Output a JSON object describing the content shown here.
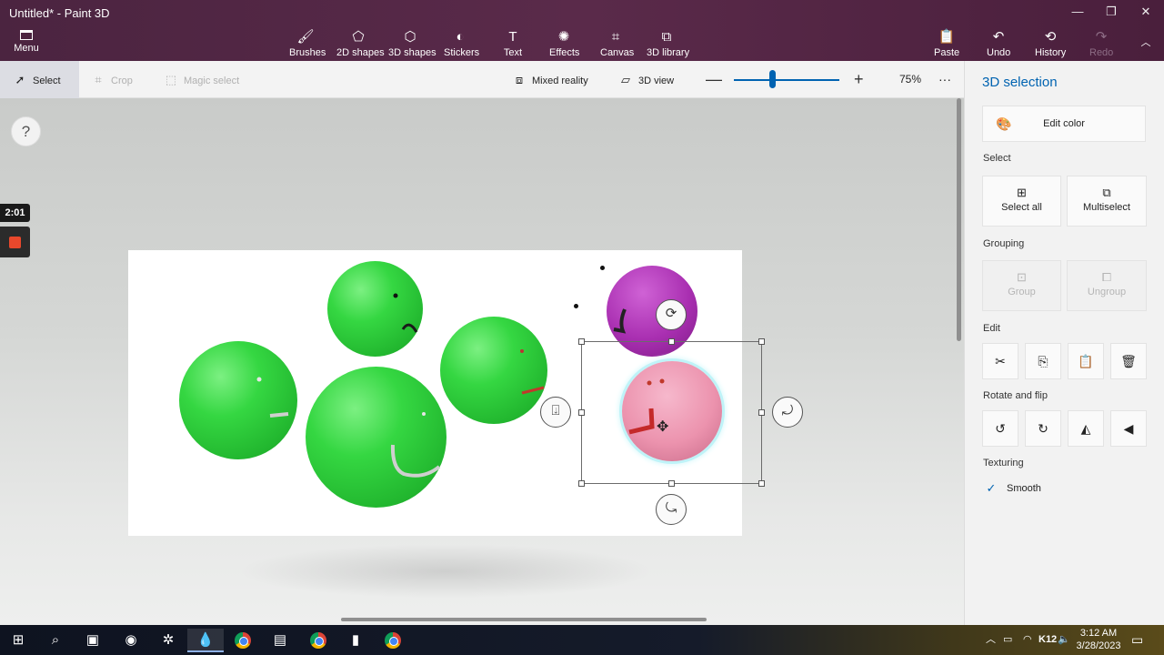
{
  "window": {
    "title": "Untitled* - Paint 3D",
    "minimize": "—",
    "maximize": "❐",
    "close": "✕"
  },
  "ribbon": {
    "menu_label": "Menu",
    "tools": [
      {
        "label": "Brushes",
        "icon": "brush-icon",
        "glyph": "🖌"
      },
      {
        "label": "2D shapes",
        "icon": "2d-shapes-icon",
        "glyph": "⬠"
      },
      {
        "label": "3D shapes",
        "icon": "3d-shapes-icon",
        "glyph": "⬡"
      },
      {
        "label": "Stickers",
        "icon": "stickers-icon",
        "glyph": "◐"
      },
      {
        "label": "Text",
        "icon": "text-icon",
        "glyph": "T"
      },
      {
        "label": "Effects",
        "icon": "effects-icon",
        "glyph": "✺"
      },
      {
        "label": "Canvas",
        "icon": "canvas-icon",
        "glyph": "⌗"
      },
      {
        "label": "3D library",
        "icon": "3d-library-icon",
        "glyph": "⧉"
      }
    ],
    "right_tools": [
      {
        "label": "Paste",
        "icon": "paste-icon",
        "glyph": "📋"
      },
      {
        "label": "Undo",
        "icon": "undo-icon",
        "glyph": "↶"
      },
      {
        "label": "History",
        "icon": "history-icon",
        "glyph": "⟲"
      },
      {
        "label": "Redo",
        "icon": "redo-icon",
        "glyph": "↷"
      }
    ],
    "collapse_glyph": "︿"
  },
  "toolbar": {
    "select": "Select",
    "crop": "Crop",
    "magic_select": "Magic select",
    "mixed_reality": "Mixed reality",
    "view_3d": "3D view",
    "zoom_minus": "—",
    "zoom_plus": "+",
    "zoom_level": "75%",
    "more": "···"
  },
  "canvas": {
    "help": "?",
    "timer": "2:01"
  },
  "panel": {
    "title": "3D selection",
    "edit_color": "Edit color",
    "select_heading": "Select",
    "select_all": "Select all",
    "multiselect": "Multiselect",
    "grouping_heading": "Grouping",
    "group": "Group",
    "ungroup": "Ungroup",
    "edit_heading": "Edit",
    "edit_buttons": [
      {
        "name": "cut-button",
        "glyph": "✂"
      },
      {
        "name": "copy-button",
        "glyph": "⎘"
      },
      {
        "name": "paste-button",
        "glyph": "📋"
      },
      {
        "name": "delete-button",
        "glyph": "🗑"
      }
    ],
    "rotate_heading": "Rotate and flip",
    "rotate_buttons": [
      {
        "name": "rotate-left-button",
        "glyph": "↺"
      },
      {
        "name": "rotate-right-button",
        "glyph": "↻"
      },
      {
        "name": "flip-horizontal-button",
        "glyph": "◭"
      },
      {
        "name": "flip-vertical-button",
        "glyph": "◀"
      }
    ],
    "texturing_heading": "Texturing",
    "smooth": "Smooth",
    "check_glyph": "✓"
  },
  "taskbar": {
    "apps": [
      {
        "name": "start-button",
        "glyph": "⊞"
      },
      {
        "name": "search-button",
        "glyph": "⌕"
      },
      {
        "name": "taskbar-app-1",
        "glyph": "▣"
      },
      {
        "name": "taskbar-app-2",
        "glyph": "◉"
      },
      {
        "name": "taskbar-app-3",
        "glyph": "✲"
      },
      {
        "name": "taskbar-paint3d",
        "glyph": "💧"
      },
      {
        "name": "taskbar-chrome-1",
        "glyph": ""
      },
      {
        "name": "taskbar-terms",
        "glyph": "▤"
      },
      {
        "name": "taskbar-chrome-2",
        "glyph": ""
      },
      {
        "name": "taskbar-app-4",
        "glyph": "▮"
      },
      {
        "name": "taskbar-chrome-3",
        "glyph": ""
      }
    ],
    "tray_label": "K12",
    "time": "3:12 AM",
    "date": "3/28/2023"
  }
}
